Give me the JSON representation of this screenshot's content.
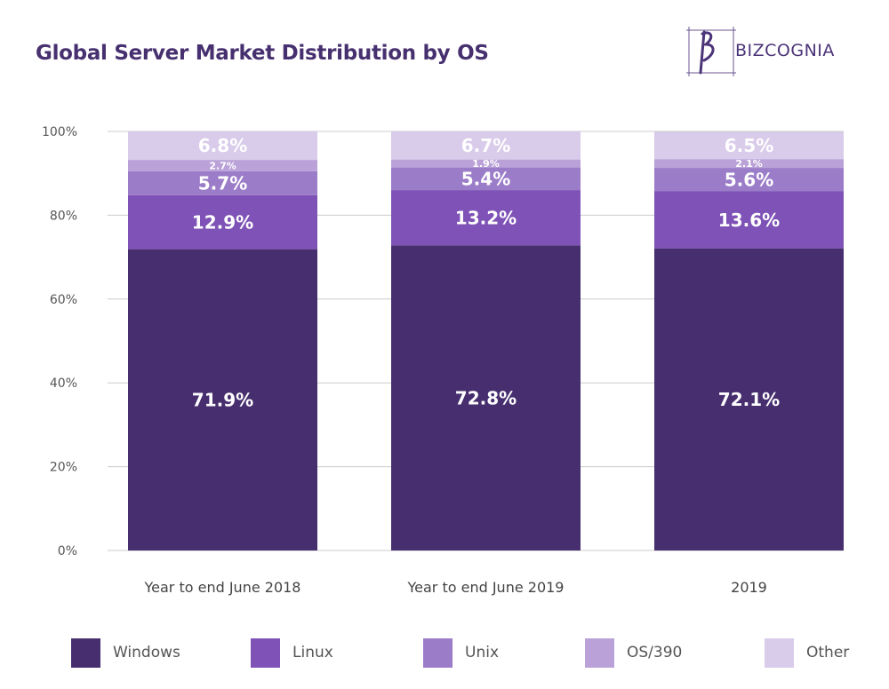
{
  "header": {
    "title": "Global Server Market Distribution by OS",
    "logo_text": "BIZCOGNIA",
    "logo_icon": "bizcognia-b-logo-icon"
  },
  "colors": {
    "title": "#47306f",
    "Windows": "#472e6e",
    "Linux": "#7e52b6",
    "Unix": "#9b7cc8",
    "OS/390": "#baa2d8",
    "Other": "#d9cbea",
    "gridline": "#cccccc"
  },
  "chart_data": {
    "type": "bar",
    "stacked": true,
    "title": "Global Server Market Distribution by OS",
    "xlabel": "",
    "ylabel": "",
    "ylim": [
      0,
      100
    ],
    "yticks": [
      0,
      20,
      40,
      60,
      80,
      100
    ],
    "ytick_labels": [
      "0%",
      "20%",
      "40%",
      "60%",
      "80%",
      "100%"
    ],
    "grid": true,
    "legend_position": "bottom",
    "categories": [
      "Year to end June 2018",
      "Year to end June 2019",
      "2019"
    ],
    "series": [
      {
        "name": "Windows",
        "values": [
          71.9,
          72.8,
          72.1
        ],
        "labels": [
          "71.9%",
          "72.8%",
          "72.1%"
        ]
      },
      {
        "name": "Linux",
        "values": [
          12.9,
          13.2,
          13.6
        ],
        "labels": [
          "12.9%",
          "13.2%",
          "13.6%"
        ]
      },
      {
        "name": "Unix",
        "values": [
          5.7,
          5.4,
          5.6
        ],
        "labels": [
          "5.7%",
          "5.4%",
          "5.6%"
        ]
      },
      {
        "name": "OS/390",
        "values": [
          2.7,
          1.9,
          2.1
        ],
        "labels": [
          "2.7%",
          "1.9%",
          "2.1%"
        ]
      },
      {
        "name": "Other",
        "values": [
          6.8,
          6.7,
          6.5
        ],
        "labels": [
          "6.8%",
          "6.7%",
          "6.5%"
        ]
      }
    ]
  }
}
